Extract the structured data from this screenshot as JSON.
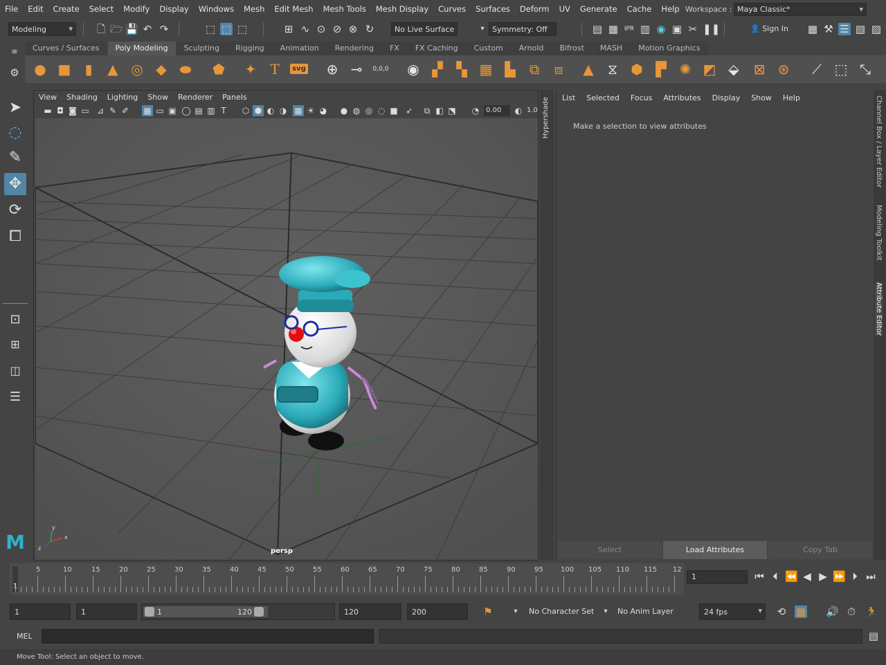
{
  "menubar": {
    "items": [
      "File",
      "Edit",
      "Create",
      "Select",
      "Modify",
      "Display",
      "Windows",
      "Mesh",
      "Edit Mesh",
      "Mesh Tools",
      "Mesh Display",
      "Curves",
      "Surfaces",
      "Deform",
      "UV",
      "Generate",
      "Cache",
      "Help"
    ],
    "workspace_label": "Workspace :",
    "workspace_value": "Maya Classic*"
  },
  "statusline": {
    "mode": "Modeling",
    "live_surface": "No Live Surface",
    "symmetry": "Symmetry: Off",
    "sign_in": "Sign In"
  },
  "shelf": {
    "tabs": [
      "Curves / Surfaces",
      "Poly Modeling",
      "Sculpting",
      "Rigging",
      "Animation",
      "Rendering",
      "FX",
      "FX Caching",
      "Custom",
      "Arnold",
      "Bifrost",
      "MASH",
      "Motion Graphics"
    ],
    "active_tab": "Poly Modeling",
    "svg_label": "svg",
    "coord_label": "0,0,0"
  },
  "viewport": {
    "menus": [
      "View",
      "Shading",
      "Lighting",
      "Show",
      "Renderer",
      "Panels"
    ],
    "exposure_value": "0.00",
    "gamma_value": "1.0",
    "camera_label": "persp"
  },
  "hypershade": {
    "label": "Hypershade"
  },
  "attribute_editor": {
    "menus": [
      "List",
      "Selected",
      "Focus",
      "Attributes",
      "Display",
      "Show",
      "Help"
    ],
    "message": "Make a selection to view attributes",
    "buttons": {
      "select": "Select",
      "load": "Load Attributes",
      "copy": "Copy Tab"
    }
  },
  "right_tabs": [
    "Channel Box / Layer Editor",
    "Modeling Toolkit",
    "Attribute Editor"
  ],
  "timeline": {
    "ticks": [
      "5",
      "10",
      "15",
      "20",
      "25",
      "30",
      "35",
      "40",
      "45",
      "50",
      "55",
      "60",
      "65",
      "70",
      "75",
      "80",
      "85",
      "90",
      "95",
      "100",
      "105",
      "110",
      "115",
      "12"
    ],
    "current_marker": "1",
    "current_frame": "1"
  },
  "range": {
    "start": "1",
    "playback_start": "1",
    "slider_start": "1",
    "slider_end": "120",
    "playback_end": "120",
    "end": "200",
    "character_set": "No Character Set",
    "anim_layer": "No Anim Layer",
    "fps": "24 fps"
  },
  "command": {
    "mel_label": "MEL"
  },
  "help_line": "Move Tool: Select an object to move."
}
